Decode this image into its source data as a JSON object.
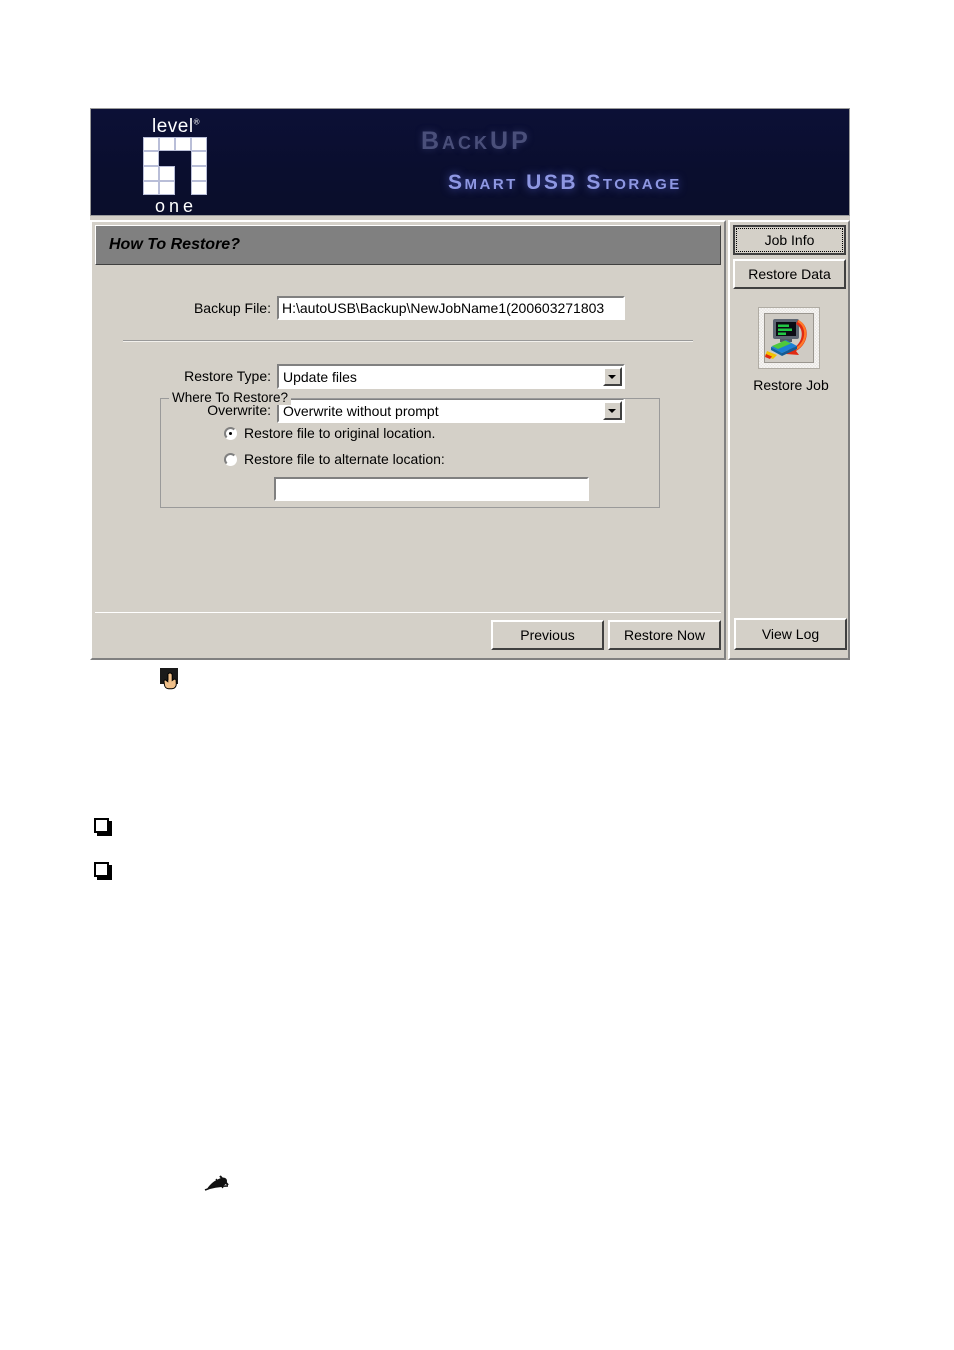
{
  "window": {
    "banner": {
      "logo_top": "level",
      "logo_registered": "®",
      "logo_bottom": "one",
      "title": "BackUP",
      "subtitle": "Smart USB Storage",
      "bg_color": "#0b0f33",
      "title_color": "#4a4f7a",
      "subtitle_color": "#8e97e2"
    },
    "panel": {
      "header_title": "How To Restore?",
      "header_bg": "#808080",
      "body_bg": "#d4d0c8",
      "fields": {
        "backup_file": {
          "label": "Backup File:",
          "value": "H:\\autoUSB\\Backup\\NewJobName1(200603271803",
          "placeholder": ""
        },
        "restore_type": {
          "label": "Restore Type:",
          "value": "Update files",
          "options": [
            "Update files"
          ]
        },
        "overwrite": {
          "label": "Overwrite:",
          "value": "Overwrite without prompt",
          "options": [
            "Overwrite without prompt"
          ]
        }
      },
      "where_to_restore": {
        "title": "Where To Restore?",
        "option_original": "Restore file to original location.",
        "option_alternate": "Restore file to alternate location:",
        "selected": "original",
        "alternate_path": "",
        "alternate_placeholder": ""
      },
      "buttons": {
        "previous": "Previous",
        "restore_now": "Restore Now"
      }
    },
    "sidebar": {
      "tabs": [
        {
          "label": "Job Info",
          "active": true
        },
        {
          "label": "Restore Data",
          "active": false
        }
      ],
      "job_icon": {
        "name": "restore-job-icon",
        "label": "Restore Job"
      },
      "view_log": "View Log"
    }
  },
  "page": {
    "cursor_icon": "pointing-hand-cursor",
    "bullets": [
      "",
      ""
    ],
    "note_glyph": "pencil-note-glyph"
  }
}
